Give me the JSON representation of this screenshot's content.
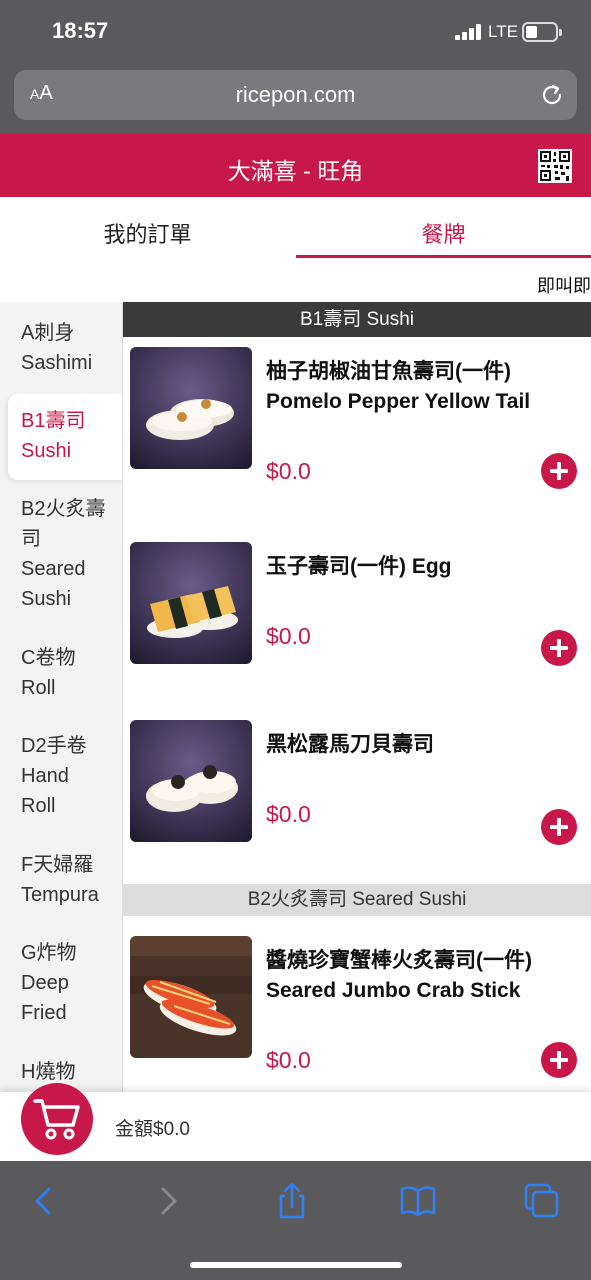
{
  "status": {
    "time": "18:57",
    "network": "LTE"
  },
  "browser": {
    "text_size_label_small": "A",
    "text_size_label_large": "A",
    "url": "ricepon.com"
  },
  "header": {
    "title": "大滿喜 - 旺角"
  },
  "tabs": {
    "orders": "我的訂單",
    "menu": "餐牌"
  },
  "instant_label": "即叫即",
  "sidebar": {
    "categories": [
      {
        "line1": "A刺身",
        "line2": "Sashimi"
      },
      {
        "line1": "B1壽司",
        "line2": "Sushi"
      },
      {
        "line1": "B2火炙壽",
        "line2": "司",
        "line3": "Seared",
        "line4": "Sushi"
      },
      {
        "line1": "C卷物",
        "line2": "Roll"
      },
      {
        "line1": "D2手卷",
        "line2": "Hand",
        "line3": "Roll"
      },
      {
        "line1": "F天婦羅",
        "line2": "Tempura"
      },
      {
        "line1": "G炸物",
        "line2": "Deep",
        "line3": "Fried"
      },
      {
        "line1": "H燒物"
      }
    ]
  },
  "sections": [
    {
      "title": "B1壽司 Sushi",
      "items": [
        {
          "name_zh": "柚子胡椒油甘魚壽司(一件)",
          "name_en": "Pomelo Pepper Yellow Tail",
          "price": "$0.0"
        },
        {
          "name_zh": "玉子壽司(一件) Egg",
          "name_en": "",
          "price": "$0.0"
        },
        {
          "name_zh": "黑松露馬刀貝壽司",
          "name_en": "",
          "price": "$0.0"
        }
      ]
    },
    {
      "title": "B2火炙壽司 Seared Sushi",
      "items": [
        {
          "name_zh": "醬燒珍寶蟹棒火炙壽司(一件)",
          "name_en": "Seared Jumbo Crab Stick",
          "price": "$0.0"
        }
      ]
    }
  ],
  "cart": {
    "total_label": "金額$0.0"
  },
  "colors": {
    "accent": "#c8184a",
    "chrome": "#5a5a5c",
    "safari_blue": "#2f7ff5"
  }
}
